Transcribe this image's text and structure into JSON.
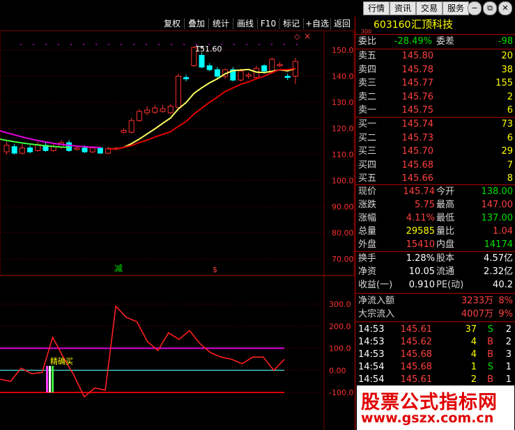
{
  "nav": {
    "buttons": [
      "行情",
      "资讯",
      "交易",
      "服务"
    ],
    "window": [
      "−",
      "⧉",
      "✕"
    ]
  },
  "toolbar": {
    "items": [
      "复权",
      "叠加",
      "统计",
      "画线",
      "F10",
      "标记",
      "+自选",
      "返回"
    ],
    "diamond": "◇",
    "close": "×"
  },
  "stock": {
    "market": "300",
    "code": "603160",
    "name": "汇顶科技"
  },
  "weibi": {
    "label": "委比",
    "value": "-28.49%",
    "label2": "委差",
    "value2": "-98"
  },
  "asks": [
    {
      "label": "卖五",
      "price": "145.80",
      "vol": "20"
    },
    {
      "label": "卖四",
      "price": "145.78",
      "vol": "38"
    },
    {
      "label": "卖三",
      "price": "145.77",
      "vol": "155"
    },
    {
      "label": "卖二",
      "price": "145.76",
      "vol": "2"
    },
    {
      "label": "卖一",
      "price": "145.75",
      "vol": "6"
    }
  ],
  "bids": [
    {
      "label": "买一",
      "price": "145.74",
      "vol": "73"
    },
    {
      "label": "买二",
      "price": "145.73",
      "vol": "6"
    },
    {
      "label": "买三",
      "price": "145.70",
      "vol": "29"
    },
    {
      "label": "买四",
      "price": "145.68",
      "vol": "7"
    },
    {
      "label": "买五",
      "price": "145.66",
      "vol": "8"
    }
  ],
  "quote": [
    {
      "l1": "现价",
      "v1": "145.74",
      "c1": "red",
      "l2": "今开",
      "v2": "138.00",
      "c2": "grn"
    },
    {
      "l1": "涨跌",
      "v1": "5.75",
      "c1": "red",
      "l2": "最高",
      "v2": "147.00",
      "c2": "red"
    },
    {
      "l1": "涨幅",
      "v1": "4.11%",
      "c1": "red",
      "l2": "最低",
      "v2": "137.00",
      "c2": "grn"
    },
    {
      "l1": "总量",
      "v1": "29585",
      "c1": "yel",
      "l2": "量比",
      "v2": "1.04",
      "c2": "red"
    },
    {
      "l1": "外盘",
      "v1": "15410",
      "c1": "red",
      "l2": "内盘",
      "v2": "14174",
      "c2": "grn"
    }
  ],
  "fund": [
    {
      "l1": "换手",
      "v1": "1.28%",
      "l2": "股本",
      "v2": "4.57亿"
    },
    {
      "l1": "净资",
      "v1": "10.05",
      "l2": "流通",
      "v2": "2.32亿"
    },
    {
      "l1": "收益(一)",
      "v1": "0.910",
      "l2": "PE(动)",
      "v2": "40.2"
    }
  ],
  "flow": [
    {
      "label": "净流入额",
      "value": "3233万",
      "pct": "8%"
    },
    {
      "label": "大宗流入",
      "value": "4007万",
      "pct": "9%"
    }
  ],
  "ticks": [
    {
      "time": "14:53",
      "price": "145.61",
      "vol": "37",
      "side": "S",
      "n": "2"
    },
    {
      "time": "14:53",
      "price": "145.62",
      "vol": "4",
      "side": "B",
      "n": "2"
    },
    {
      "time": "14:53",
      "price": "145.68",
      "vol": "4",
      "side": "B",
      "n": "3"
    },
    {
      "time": "14:54",
      "price": "145.68",
      "vol": "1",
      "side": "S",
      "n": "1"
    },
    {
      "time": "14:54",
      "price": "145.61",
      "vol": "2",
      "side": "B",
      "n": "1"
    }
  ],
  "watermark": {
    "line1": "股票公式指标网",
    "line2": "www.gszx.com.cn"
  },
  "colors": {
    "up": "#ff3030",
    "down": "#00ffff",
    "ma_yellow": "#ffff60",
    "ma_red": "#e00000",
    "ma_magenta": "#e000e0",
    "ma_green": "#40ff40",
    "grid": "#7a0000"
  },
  "chart_data": [
    {
      "type": "candlestick",
      "ylim": [
        65,
        155
      ],
      "y_ticks": [
        "150.0",
        "140.0",
        "130.0",
        "120.0",
        "110.0",
        "100.0",
        "90.00",
        "80.00",
        "70.00"
      ],
      "annotations": {
        "high_label": "151.60",
        "marker_jian": "减",
        "marker_s": "$"
      },
      "candles": [
        {
          "o": 111,
          "c": 113.5,
          "h": 115,
          "l": 110
        },
        {
          "o": 113,
          "c": 110.5,
          "h": 114,
          "l": 110
        },
        {
          "o": 110.5,
          "c": 112.5,
          "h": 114,
          "l": 110
        },
        {
          "o": 112.5,
          "c": 111,
          "h": 113.5,
          "l": 110.5
        },
        {
          "o": 111.5,
          "c": 113.8,
          "h": 114.8,
          "l": 111
        },
        {
          "o": 113.5,
          "c": 111.5,
          "h": 115,
          "l": 111
        },
        {
          "o": 111.5,
          "c": 113,
          "h": 114,
          "l": 111
        },
        {
          "o": 112.8,
          "c": 114.5,
          "h": 115.5,
          "l": 112
        },
        {
          "o": 114.5,
          "c": 111.5,
          "h": 115.5,
          "l": 111
        },
        {
          "o": 112,
          "c": 112.5,
          "h": 113.5,
          "l": 111.5
        },
        {
          "o": 112.5,
          "c": 111,
          "h": 113.5,
          "l": 110.5
        },
        {
          "o": 111,
          "c": 112.5,
          "h": 113.2,
          "l": 110.5
        },
        {
          "o": 112.5,
          "c": 110.5,
          "h": 113,
          "l": 110.3
        },
        {
          "o": 110.5,
          "c": 112.2,
          "h": 113,
          "l": 110.2
        },
        {
          "o": 112,
          "c": 112.3,
          "h": 113,
          "l": 111.5
        },
        {
          "o": 118.5,
          "c": 119.2,
          "h": 120,
          "l": 118
        },
        {
          "o": 118.5,
          "c": 123,
          "h": 124,
          "l": 118
        },
        {
          "o": 123,
          "c": 126.5,
          "h": 127.5,
          "l": 122.5
        },
        {
          "o": 126,
          "c": 127,
          "h": 128.5,
          "l": 125
        },
        {
          "o": 126.2,
          "c": 127.8,
          "h": 129,
          "l": 125.5
        },
        {
          "o": 126.5,
          "c": 127.5,
          "h": 129,
          "l": 126
        },
        {
          "o": 126,
          "c": 128.5,
          "h": 129.2,
          "l": 125.5
        },
        {
          "o": 128,
          "c": 140,
          "h": 141,
          "l": 127.5
        },
        {
          "o": 139.5,
          "c": 139,
          "h": 140.5,
          "l": 138
        },
        {
          "o": 144,
          "c": 151,
          "h": 151.6,
          "l": 143.5
        },
        {
          "o": 148,
          "c": 143.5,
          "h": 149,
          "l": 143
        },
        {
          "o": 144,
          "c": 142.5,
          "h": 145,
          "l": 142
        },
        {
          "o": 142.5,
          "c": 140,
          "h": 143.5,
          "l": 139
        },
        {
          "o": 140,
          "c": 142.5,
          "h": 143,
          "l": 139
        },
        {
          "o": 142.5,
          "c": 138.5,
          "h": 143.5,
          "l": 138
        },
        {
          "o": 138.5,
          "c": 142,
          "h": 142.8,
          "l": 138
        },
        {
          "o": 140,
          "c": 140.5,
          "h": 141.5,
          "l": 139
        },
        {
          "o": 139.5,
          "c": 143,
          "h": 144,
          "l": 139
        },
        {
          "o": 144,
          "c": 142,
          "h": 144.5,
          "l": 141
        },
        {
          "o": 141.5,
          "c": 146.5,
          "h": 147.2,
          "l": 141
        },
        {
          "o": 144,
          "c": 144.5,
          "h": 145.5,
          "l": 143.5
        },
        {
          "o": 140,
          "c": 139.5,
          "h": 141,
          "l": 138.5
        },
        {
          "o": 140,
          "c": 145.7,
          "h": 147,
          "l": 137
        }
      ]
    },
    {
      "type": "line",
      "ylim": [
        -120,
        340
      ],
      "y_ticks": [
        "300.0",
        "200.0",
        "100.0",
        "0.00",
        "-100.0"
      ],
      "reference_lines": [
        100,
        0,
        -100
      ],
      "signal_label": "精确买",
      "values": [
        -40,
        -50,
        10,
        -15,
        -10,
        150,
        60,
        -20,
        -120,
        -80,
        -90,
        290,
        240,
        220,
        130,
        90,
        170,
        140,
        180,
        120,
        80,
        60,
        50,
        30,
        60,
        60,
        0,
        50
      ]
    }
  ]
}
